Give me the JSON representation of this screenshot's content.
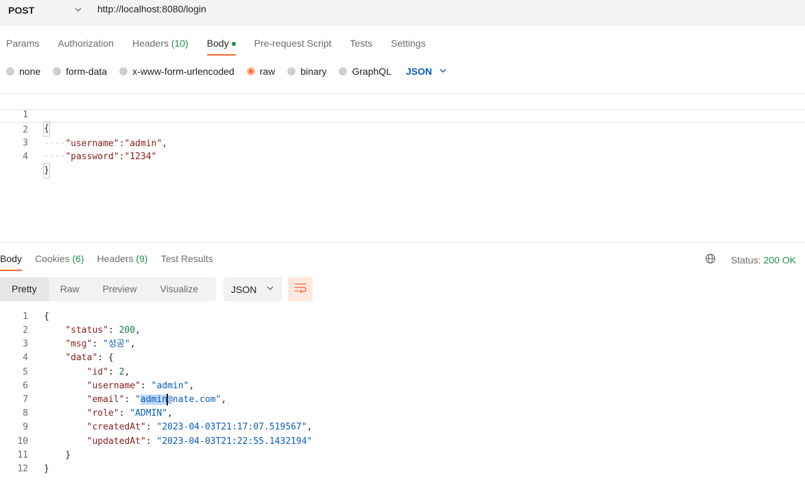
{
  "request": {
    "method": "POST",
    "url": "http://localhost:8080/login",
    "tabs": [
      {
        "label": "Params"
      },
      {
        "label": "Authorization"
      },
      {
        "label": "Headers",
        "count": "(10)"
      },
      {
        "label": "Body"
      },
      {
        "label": "Pre-request Script"
      },
      {
        "label": "Tests"
      },
      {
        "label": "Settings"
      }
    ],
    "active_tab": "Body",
    "body_types": [
      "none",
      "form-data",
      "x-www-form-urlencoded",
      "raw",
      "binary",
      "GraphQL"
    ],
    "selected_body_type": "raw",
    "language": "JSON",
    "body_lines": [
      {
        "n": "1",
        "text": "{"
      },
      {
        "n": "2",
        "text": "\"username\":\"admin\","
      },
      {
        "n": "3",
        "text": "\"password\":\"1234\""
      },
      {
        "n": "4",
        "text": "}"
      }
    ]
  },
  "response": {
    "tabs": [
      {
        "label": "Body"
      },
      {
        "label": "Cookies",
        "count": "(6)"
      },
      {
        "label": "Headers",
        "count": "(9)"
      },
      {
        "label": "Test Results"
      }
    ],
    "status_label": "Status:",
    "status_value": "200 OK",
    "view_tabs": [
      "Pretty",
      "Raw",
      "Preview",
      "Visualize"
    ],
    "active_view": "Pretty",
    "format": "JSON",
    "line_numbers": [
      "1",
      "2",
      "3",
      "4",
      "5",
      "6",
      "7",
      "8",
      "9",
      "10",
      "11",
      "12"
    ],
    "json": {
      "status_key": "\"status\"",
      "status_val": "200",
      "msg_key": "\"msg\"",
      "msg_val": "\"성공\"",
      "data_key": "\"data\"",
      "id_key": "\"id\"",
      "id_val": "2",
      "username_key": "\"username\"",
      "username_val": "\"admin\"",
      "email_key": "\"email\"",
      "email_pre": "\"",
      "email_sel": "admin",
      "email_post": "@nate.com\"",
      "role_key": "\"role\"",
      "role_val": "\"ADMIN\"",
      "createdAt_key": "\"createdAt\"",
      "createdAt_val": "\"2023-04-03T21:17:07.519567\"",
      "updatedAt_key": "\"updatedAt\"",
      "updatedAt_val": "\"2023-04-03T21:22:55.1432194\""
    }
  },
  "colors": {
    "accent": "#ff6c37",
    "success": "#1f8c4a",
    "string": "#0b5bbf",
    "key": "#8a1c1c"
  }
}
